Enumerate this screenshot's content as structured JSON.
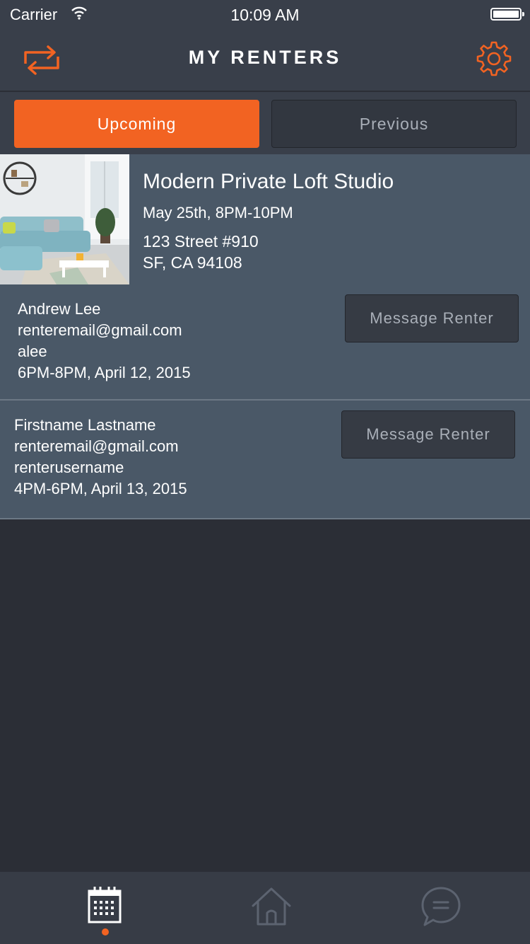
{
  "status_bar": {
    "carrier": "Carrier",
    "time": "10:09 AM"
  },
  "nav": {
    "title": "MY RENTERS",
    "left_icon": "swap-icon",
    "right_icon": "gear-icon"
  },
  "segments": {
    "upcoming": "Upcoming",
    "previous": "Previous",
    "active": "Upcoming"
  },
  "listing": {
    "title": "Modern Private Loft Studio",
    "time": "May 25th, 8PM-10PM",
    "address_line1": "123 Street #910",
    "address_line2": "SF, CA 94108"
  },
  "renters": [
    {
      "name": "Andrew Lee",
      "email": "renteremail@gmail.com",
      "username": "alee",
      "time": "6PM-8PM, April 12, 2015",
      "button": "Message Renter"
    },
    {
      "name": "Firstname Lastname",
      "email": "renteremail@gmail.com",
      "username": "renterusername",
      "time": "4PM-6PM, April 13, 2015",
      "button": "Message Renter"
    }
  ],
  "tabbar": {
    "items": [
      "calendar-icon",
      "home-icon",
      "chat-icon"
    ],
    "active": "calendar-icon"
  },
  "colors": {
    "accent": "#f26322",
    "nav_bg": "#393f4a",
    "card_bg": "#4a5867",
    "page_bg": "#2b2e36"
  }
}
